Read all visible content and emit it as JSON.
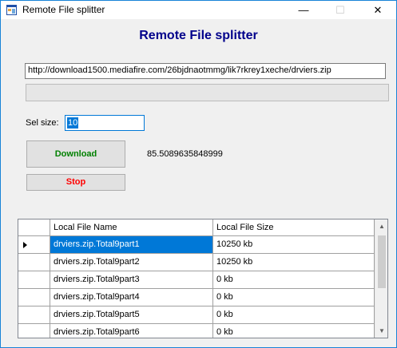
{
  "window": {
    "title": "Remote File splitter",
    "min_glyph": "—",
    "max_glyph": "☐",
    "close_glyph": "✕"
  },
  "heading": "Remote File splitter",
  "url": "http://download1500.mediafire.com/26bjdnaotmmg/lik7rkrey1xeche/drviers.zip",
  "progress_fraction": 0,
  "sel_size": {
    "label": "Sel size:",
    "value": "10"
  },
  "buttons": {
    "download": "Download",
    "stop": "Stop"
  },
  "speed_value": "85.5089635848999",
  "table": {
    "columns": [
      "Local File Name",
      "Local File Size"
    ],
    "rows": [
      {
        "name": "drviers.zip.Total9part1",
        "size": "10250 kb"
      },
      {
        "name": "drviers.zip.Total9part2",
        "size": "10250 kb"
      },
      {
        "name": "drviers.zip.Total9part3",
        "size": "0 kb"
      },
      {
        "name": "drviers.zip.Total9part4",
        "size": "0 kb"
      },
      {
        "name": "drviers.zip.Total9part5",
        "size": "0 kb"
      },
      {
        "name": "drviers.zip.Total9part6",
        "size": "0 kb"
      }
    ]
  },
  "colors": {
    "heading": "#00008b",
    "download": "#008000",
    "stop": "#ff0000",
    "selection": "#0078d7"
  }
}
